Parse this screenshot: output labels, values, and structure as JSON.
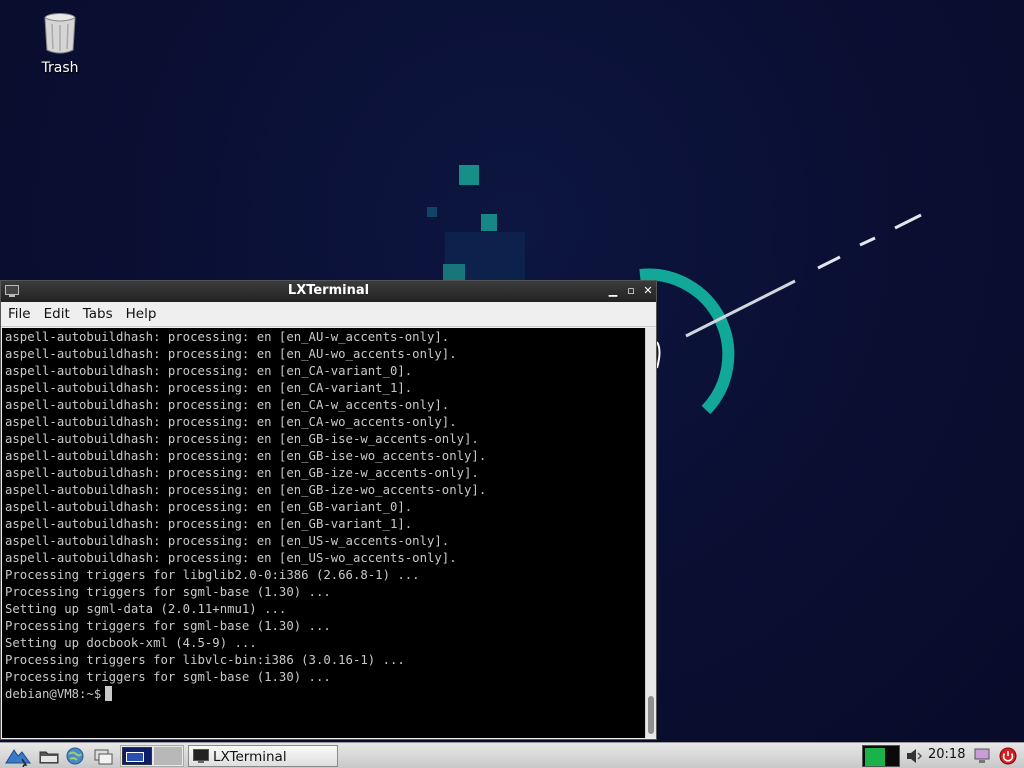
{
  "desktop": {
    "icons": [
      {
        "label": "Trash",
        "icon": "trash-icon"
      }
    ]
  },
  "terminal": {
    "title": "LXTerminal",
    "menu": [
      "File",
      "Edit",
      "Tabs",
      "Help"
    ],
    "lines": [
      "aspell-autobuildhash: processing: en [en_AU-w_accents-only].",
      "aspell-autobuildhash: processing: en [en_AU-wo_accents-only].",
      "aspell-autobuildhash: processing: en [en_CA-variant_0].",
      "aspell-autobuildhash: processing: en [en_CA-variant_1].",
      "aspell-autobuildhash: processing: en [en_CA-w_accents-only].",
      "aspell-autobuildhash: processing: en [en_CA-wo_accents-only].",
      "aspell-autobuildhash: processing: en [en_GB-ise-w_accents-only].",
      "aspell-autobuildhash: processing: en [en_GB-ise-wo_accents-only].",
      "aspell-autobuildhash: processing: en [en_GB-ize-w_accents-only].",
      "aspell-autobuildhash: processing: en [en_GB-ize-wo_accents-only].",
      "aspell-autobuildhash: processing: en [en_GB-variant_0].",
      "aspell-autobuildhash: processing: en [en_GB-variant_1].",
      "aspell-autobuildhash: processing: en [en_US-w_accents-only].",
      "aspell-autobuildhash: processing: en [en_US-wo_accents-only].",
      "Processing triggers for libglib2.0-0:i386 (2.66.8-1) ...",
      "Processing triggers for sgml-base (1.30) ...",
      "Setting up sgml-data (2.0.11+nmu1) ...",
      "Processing triggers for sgml-base (1.30) ...",
      "Setting up docbook-xml (4.5-9) ...",
      "Processing triggers for libvlc-bin:i386 (3.0.16-1) ...",
      "Processing triggers for sgml-base (1.30) ..."
    ],
    "prompt": "debian@VM8:~$"
  },
  "taskbar": {
    "launchers": [
      "menu-icon",
      "file-manager-icon",
      "web-browser-icon",
      "show-desktop-icon",
      "workspace-pager-icon"
    ],
    "tasks": [
      {
        "label": "LXTerminal",
        "icon": "terminal-icon"
      }
    ],
    "tray": [
      "network-monitor-icon",
      "volume-icon"
    ],
    "clock": "20:18",
    "tray_right": [
      "lock-screen-icon",
      "power-icon"
    ]
  },
  "colors": {
    "desktop_bg": "#0a1035",
    "accent_teal": "#11a89a",
    "terminal_bg": "#000000",
    "terminal_fg": "#c9c9c9"
  }
}
